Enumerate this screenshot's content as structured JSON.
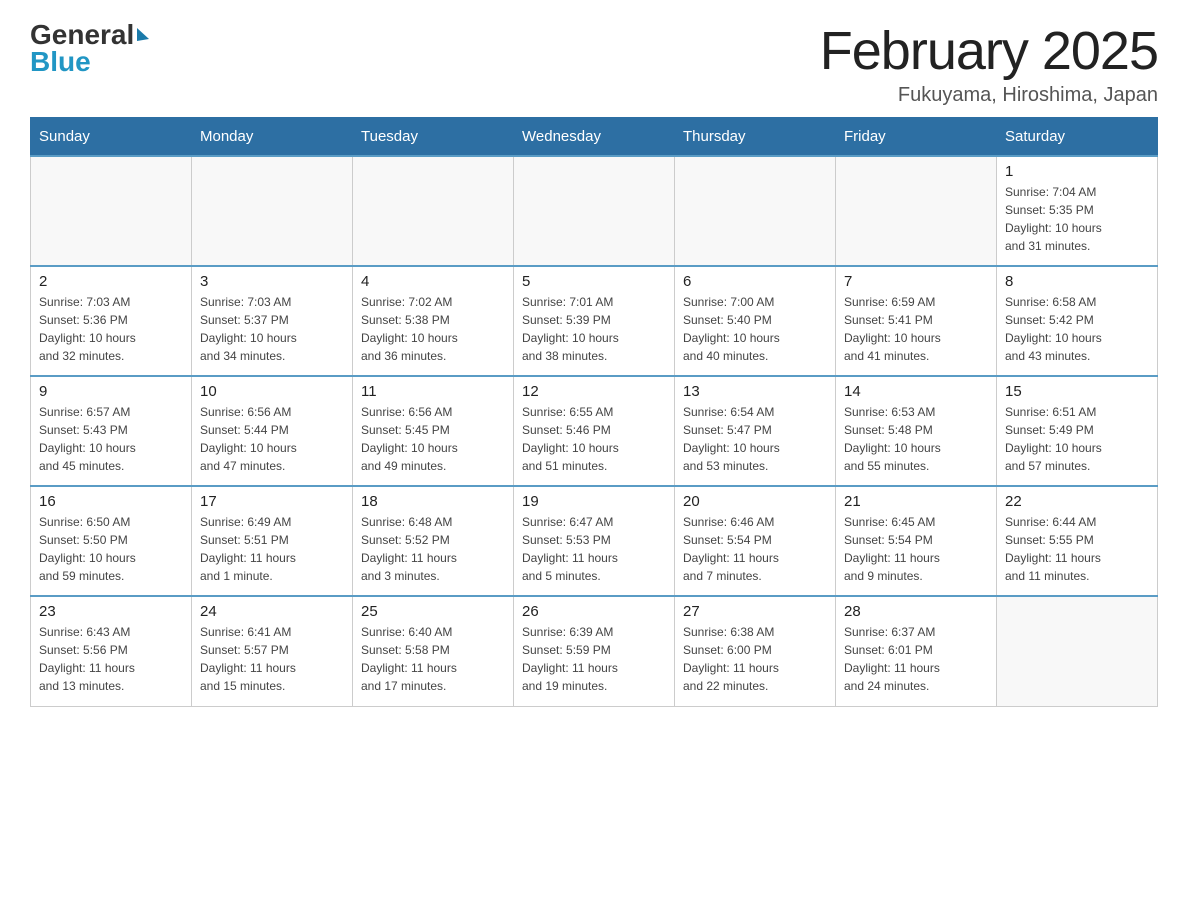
{
  "logo": {
    "general": "General",
    "blue": "Blue"
  },
  "title": "February 2025",
  "location": "Fukuyama, Hiroshima, Japan",
  "days_of_week": [
    "Sunday",
    "Monday",
    "Tuesday",
    "Wednesday",
    "Thursday",
    "Friday",
    "Saturday"
  ],
  "weeks": [
    [
      {
        "day": "",
        "info": ""
      },
      {
        "day": "",
        "info": ""
      },
      {
        "day": "",
        "info": ""
      },
      {
        "day": "",
        "info": ""
      },
      {
        "day": "",
        "info": ""
      },
      {
        "day": "",
        "info": ""
      },
      {
        "day": "1",
        "info": "Sunrise: 7:04 AM\nSunset: 5:35 PM\nDaylight: 10 hours\nand 31 minutes."
      }
    ],
    [
      {
        "day": "2",
        "info": "Sunrise: 7:03 AM\nSunset: 5:36 PM\nDaylight: 10 hours\nand 32 minutes."
      },
      {
        "day": "3",
        "info": "Sunrise: 7:03 AM\nSunset: 5:37 PM\nDaylight: 10 hours\nand 34 minutes."
      },
      {
        "day": "4",
        "info": "Sunrise: 7:02 AM\nSunset: 5:38 PM\nDaylight: 10 hours\nand 36 minutes."
      },
      {
        "day": "5",
        "info": "Sunrise: 7:01 AM\nSunset: 5:39 PM\nDaylight: 10 hours\nand 38 minutes."
      },
      {
        "day": "6",
        "info": "Sunrise: 7:00 AM\nSunset: 5:40 PM\nDaylight: 10 hours\nand 40 minutes."
      },
      {
        "day": "7",
        "info": "Sunrise: 6:59 AM\nSunset: 5:41 PM\nDaylight: 10 hours\nand 41 minutes."
      },
      {
        "day": "8",
        "info": "Sunrise: 6:58 AM\nSunset: 5:42 PM\nDaylight: 10 hours\nand 43 minutes."
      }
    ],
    [
      {
        "day": "9",
        "info": "Sunrise: 6:57 AM\nSunset: 5:43 PM\nDaylight: 10 hours\nand 45 minutes."
      },
      {
        "day": "10",
        "info": "Sunrise: 6:56 AM\nSunset: 5:44 PM\nDaylight: 10 hours\nand 47 minutes."
      },
      {
        "day": "11",
        "info": "Sunrise: 6:56 AM\nSunset: 5:45 PM\nDaylight: 10 hours\nand 49 minutes."
      },
      {
        "day": "12",
        "info": "Sunrise: 6:55 AM\nSunset: 5:46 PM\nDaylight: 10 hours\nand 51 minutes."
      },
      {
        "day": "13",
        "info": "Sunrise: 6:54 AM\nSunset: 5:47 PM\nDaylight: 10 hours\nand 53 minutes."
      },
      {
        "day": "14",
        "info": "Sunrise: 6:53 AM\nSunset: 5:48 PM\nDaylight: 10 hours\nand 55 minutes."
      },
      {
        "day": "15",
        "info": "Sunrise: 6:51 AM\nSunset: 5:49 PM\nDaylight: 10 hours\nand 57 minutes."
      }
    ],
    [
      {
        "day": "16",
        "info": "Sunrise: 6:50 AM\nSunset: 5:50 PM\nDaylight: 10 hours\nand 59 minutes."
      },
      {
        "day": "17",
        "info": "Sunrise: 6:49 AM\nSunset: 5:51 PM\nDaylight: 11 hours\nand 1 minute."
      },
      {
        "day": "18",
        "info": "Sunrise: 6:48 AM\nSunset: 5:52 PM\nDaylight: 11 hours\nand 3 minutes."
      },
      {
        "day": "19",
        "info": "Sunrise: 6:47 AM\nSunset: 5:53 PM\nDaylight: 11 hours\nand 5 minutes."
      },
      {
        "day": "20",
        "info": "Sunrise: 6:46 AM\nSunset: 5:54 PM\nDaylight: 11 hours\nand 7 minutes."
      },
      {
        "day": "21",
        "info": "Sunrise: 6:45 AM\nSunset: 5:54 PM\nDaylight: 11 hours\nand 9 minutes."
      },
      {
        "day": "22",
        "info": "Sunrise: 6:44 AM\nSunset: 5:55 PM\nDaylight: 11 hours\nand 11 minutes."
      }
    ],
    [
      {
        "day": "23",
        "info": "Sunrise: 6:43 AM\nSunset: 5:56 PM\nDaylight: 11 hours\nand 13 minutes."
      },
      {
        "day": "24",
        "info": "Sunrise: 6:41 AM\nSunset: 5:57 PM\nDaylight: 11 hours\nand 15 minutes."
      },
      {
        "day": "25",
        "info": "Sunrise: 6:40 AM\nSunset: 5:58 PM\nDaylight: 11 hours\nand 17 minutes."
      },
      {
        "day": "26",
        "info": "Sunrise: 6:39 AM\nSunset: 5:59 PM\nDaylight: 11 hours\nand 19 minutes."
      },
      {
        "day": "27",
        "info": "Sunrise: 6:38 AM\nSunset: 6:00 PM\nDaylight: 11 hours\nand 22 minutes."
      },
      {
        "day": "28",
        "info": "Sunrise: 6:37 AM\nSunset: 6:01 PM\nDaylight: 11 hours\nand 24 minutes."
      },
      {
        "day": "",
        "info": ""
      }
    ]
  ]
}
